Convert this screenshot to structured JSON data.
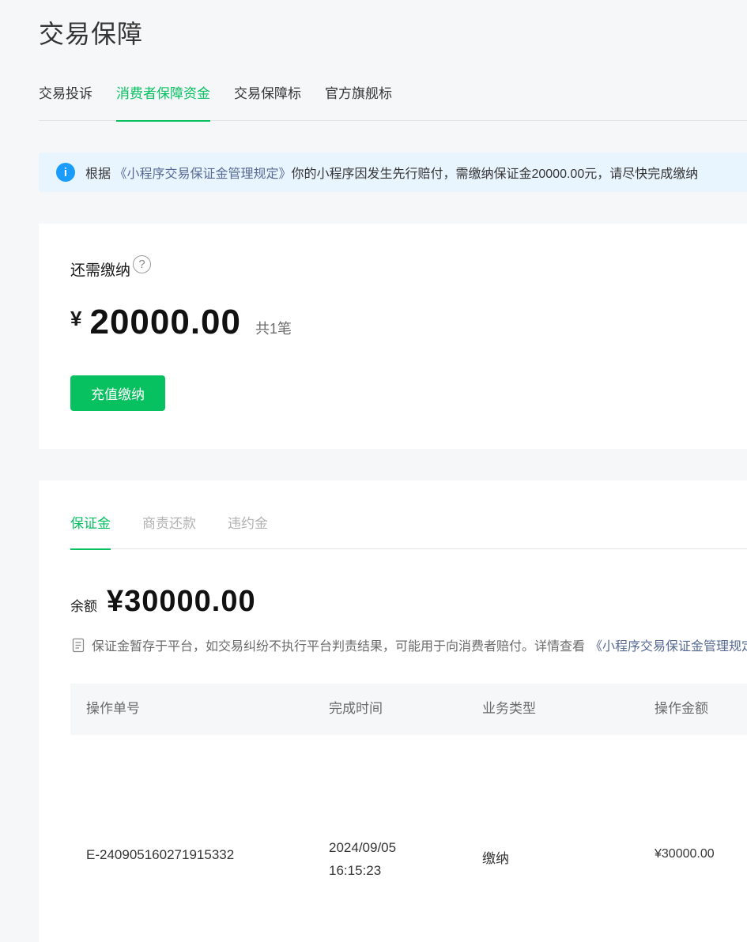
{
  "header": {
    "title": "交易保障"
  },
  "top_tabs": [
    {
      "label": "交易投诉",
      "active": false
    },
    {
      "label": "消费者保障资金",
      "active": true
    },
    {
      "label": "交易保障标",
      "active": false
    },
    {
      "label": "官方旗舰标",
      "active": false
    }
  ],
  "notice": {
    "prefix": "根据",
    "link": "《小程序交易保证金管理规定》",
    "text": "你的小程序因发生先行赔付，需缴纳保证金20000.00元，请尽快完成缴纳"
  },
  "due": {
    "label": "还需缴纳",
    "help_icon": "?",
    "currency": "¥",
    "amount": "20000.00",
    "count": "共1笔",
    "button": "充值缴纳"
  },
  "sub_tabs": [
    {
      "label": "保证金",
      "active": true
    },
    {
      "label": "商责还款",
      "active": false
    },
    {
      "label": "违约金",
      "active": false
    }
  ],
  "balance": {
    "label": "余额",
    "value": "¥30000.00"
  },
  "note": {
    "text": "保证金暂存于平台，如交易纠纷不执行平台判责结果，可能用于向消费者赔付。详情查看",
    "link": "《小程序交易保证金管理规定》"
  },
  "table": {
    "columns": [
      "操作单号",
      "完成时间",
      "业务类型",
      "操作金额"
    ],
    "rows": [
      {
        "order_no": "E-240905160271915332",
        "date": "2024/09/05",
        "time": "16:15:23",
        "type": "缴纳",
        "amount": "¥30000.00"
      }
    ]
  },
  "colors": {
    "accent": "#07c160",
    "link": "#576b95",
    "info": "#1a9cff"
  },
  "icons": [
    "info-icon",
    "help-icon",
    "document-icon"
  ]
}
